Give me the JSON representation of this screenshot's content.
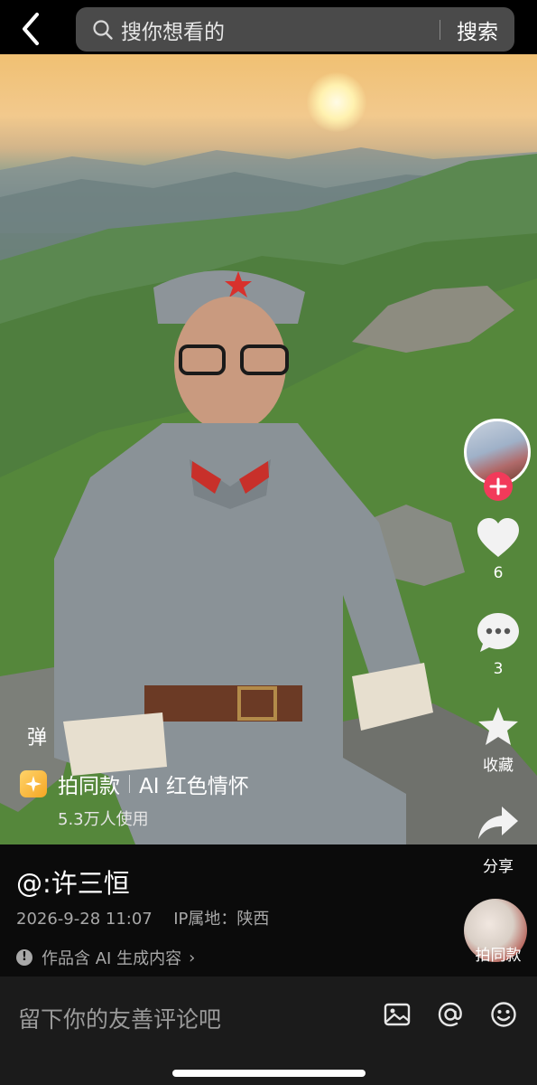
{
  "header": {
    "search_placeholder": "搜你想看的",
    "search_button": "搜索"
  },
  "video": {
    "danmu_label": "弹"
  },
  "actions": {
    "like_count": "6",
    "comment_count": "3",
    "favorite_label": "收藏",
    "share_label": "分享",
    "same_style_label": "拍同款"
  },
  "template": {
    "title": "拍同款",
    "name": "AI 红色情怀",
    "users": "5.3万人使用"
  },
  "post": {
    "author": "@:许三恒",
    "datetime": "2026-9-28 11:07",
    "ip_location": "IP属地：陕西",
    "ai_notice": "作品含 AI 生成内容"
  },
  "comment_bar": {
    "placeholder": "留下你的友善评论吧"
  },
  "colors": {
    "follow_accent": "#f23a5a",
    "template_icon": "#f6a623"
  },
  "icons": [
    "back-icon",
    "search-icon",
    "plus-icon",
    "heart-icon",
    "comment-icon",
    "star-icon",
    "share-icon",
    "sparkle-icon",
    "info-icon",
    "image-icon",
    "at-icon",
    "emoji-icon"
  ]
}
